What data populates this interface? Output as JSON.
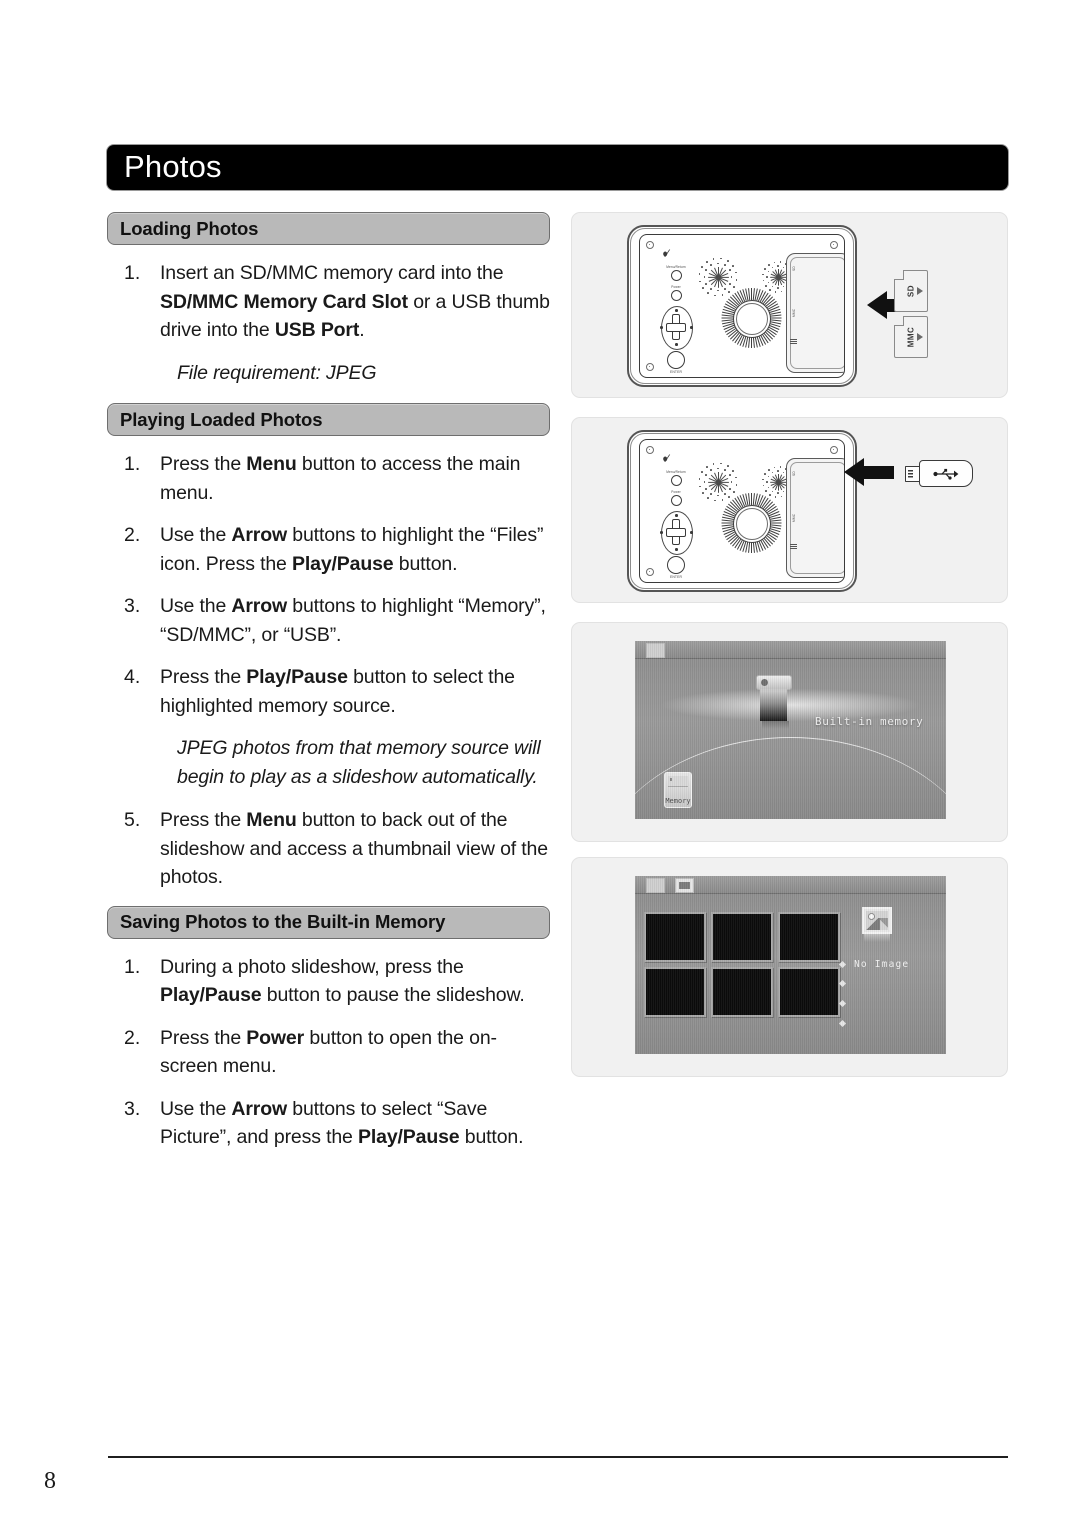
{
  "chapter": {
    "title": "Photos"
  },
  "sections": [
    {
      "heading": "Loading Photos",
      "steps": [
        {
          "num": "1.",
          "parts": [
            {
              "t": "Insert an SD/MMC memory card into the ",
              "b": false
            },
            {
              "t": "SD/MMC Memory Card Slot",
              "b": true
            },
            {
              "t": " or a USB thumb drive into the ",
              "b": false
            },
            {
              "t": "USB Port",
              "b": true
            },
            {
              "t": ".",
              "b": false
            }
          ]
        }
      ],
      "notes": [
        "File requirement: JPEG"
      ]
    },
    {
      "heading": "Playing Loaded Photos",
      "steps": [
        {
          "num": "1.",
          "parts": [
            {
              "t": "Press the ",
              "b": false
            },
            {
              "t": "Menu",
              "b": true
            },
            {
              "t": " button to access the main menu.",
              "b": false
            }
          ]
        },
        {
          "num": "2.",
          "parts": [
            {
              "t": "Use the ",
              "b": false
            },
            {
              "t": "Arrow",
              "b": true
            },
            {
              "t": " buttons to highlight the “Files” icon. Press the ",
              "b": false
            },
            {
              "t": "Play/Pause",
              "b": true
            },
            {
              "t": " button.",
              "b": false
            }
          ]
        },
        {
          "num": "3.",
          "parts": [
            {
              "t": "Use the ",
              "b": false
            },
            {
              "t": "Arrow",
              "b": true
            },
            {
              "t": " buttons to highlight “Memory”, “SD/MMC”, or “USB”.",
              "b": false
            }
          ]
        },
        {
          "num": "4.",
          "parts": [
            {
              "t": "Press the ",
              "b": false
            },
            {
              "t": "Play/Pause",
              "b": true
            },
            {
              "t": " button to select the highlighted memory source.",
              "b": false
            }
          ]
        }
      ],
      "notes": [
        "JPEG photos from that memory source will begin to play as a slideshow automatically."
      ],
      "steps_after_note": [
        {
          "num": "5.",
          "parts": [
            {
              "t": "Press the ",
              "b": false
            },
            {
              "t": "Menu",
              "b": true
            },
            {
              "t": " button to back out of the slideshow and access a thumbnail view of the photos.",
              "b": false
            }
          ]
        }
      ]
    },
    {
      "heading": "Saving Photos to the Built-in Memory",
      "steps": [
        {
          "num": "1.",
          "parts": [
            {
              "t": "During a photo slideshow, press the ",
              "b": false
            },
            {
              "t": "Play/Pause",
              "b": true
            },
            {
              "t": " button to pause the slideshow.",
              "b": false
            }
          ]
        },
        {
          "num": "2.",
          "parts": [
            {
              "t": "Press the ",
              "b": false
            },
            {
              "t": "Power",
              "b": true
            },
            {
              "t": " button to open the on-screen menu.",
              "b": false
            }
          ]
        },
        {
          "num": "3.",
          "parts": [
            {
              "t": "Use the ",
              "b": false
            },
            {
              "t": "Arrow",
              "b": true
            },
            {
              "t": " buttons to select “Save Picture”, and press the ",
              "b": false
            },
            {
              "t": "Play/Pause",
              "b": true
            },
            {
              "t": " button.",
              "b": false
            }
          ]
        }
      ],
      "notes": []
    }
  ],
  "illustrations": {
    "sd_panel": {
      "name": "device-with-memory-cards",
      "device_controls": {
        "button_top_label": "Menu/Return",
        "button_second_label": "Power",
        "dpad_label": "Arrow",
        "enter_label": "ENTER"
      },
      "cards": [
        {
          "label": "SD"
        },
        {
          "label": "MMC"
        }
      ],
      "slot_labels": [
        "SD",
        "MMC",
        "USB"
      ]
    },
    "usb_panel": {
      "name": "device-with-usb-drive",
      "drive_icon": "usb-trident-icon"
    },
    "menu_panel": {
      "name": "memory-source-menu-screenshot",
      "selected_label": "Built-in memory",
      "card_icon_label": "Memory"
    },
    "thumbs_panel": {
      "name": "thumbnail-view-screenshot",
      "status_label": "No Image",
      "thumbnail_count": 6
    }
  },
  "footer": {
    "page_number": "8"
  },
  "colors": {
    "chapter_bar": "#000000",
    "section_head": "#b9b9b9",
    "panel_bg": "#f1f1f1",
    "text": "#1a1a1a"
  }
}
